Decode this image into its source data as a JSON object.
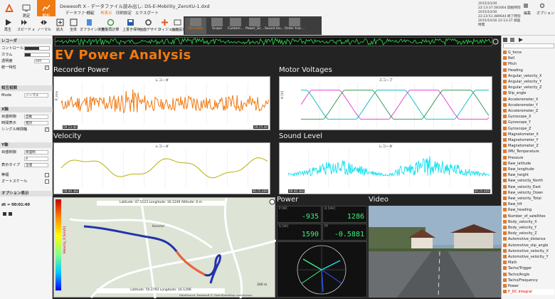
{
  "window": {
    "title": "Dewesoft X - データファイル読み出し: DS-E-Mobility_ZeroXU-1.dxd"
  },
  "main_buttons": [
    {
      "label": "測定"
    },
    {
      "label": "解析"
    }
  ],
  "ribbon_tabs": [
    {
      "label": "データファイル"
    },
    {
      "label": "設定"
    },
    {
      "label": "再表示"
    },
    {
      "label": "印刷設定"
    },
    {
      "label": "エクスポート"
    }
  ],
  "toolbar": [
    {
      "label": "再生"
    },
    {
      "label": "スピード x"
    },
    {
      "label": "ノーマル"
    },
    {
      "label": "拡大"
    },
    {
      "label": "全体"
    },
    {
      "label": "オフライン演算"
    },
    {
      "label": "自動再計算"
    },
    {
      "label": "上書き保存"
    },
    {
      "label": "画面デザイン"
    },
    {
      "label": "ウィジェット"
    },
    {
      "label": "画面設定"
    }
  ],
  "visual_tabs": [
    {
      "label": "Recorder"
    },
    {
      "label": "Scope"
    },
    {
      "label": "Custom..."
    },
    {
      "label": "Power_Sc..."
    },
    {
      "label": "Sound lev..."
    },
    {
      "label": "Order trac..."
    }
  ],
  "top_right": {
    "times": [
      "2015/10/30 22:13:37.581664 開始時刻",
      "2015/10/30 22:23:51.489644 終了時刻",
      "2015/10/30 22:13:37 録画時間"
    ],
    "edit": "編集",
    "options": "オプション"
  },
  "left_panel": {
    "recorder_section": "レコーダ",
    "rows": [
      {
        "label": "コントロール",
        "kind": "slider"
      },
      {
        "label": "カラム",
        "kind": "slider"
      },
      {
        "label": "透明度",
        "value": "OFF"
      },
      {
        "label": "統一特性",
        "kind": "check"
      }
    ],
    "timebase_section": "相互相関",
    "mode_label": "Mode",
    "mode_value": "ノーマル",
    "x_section": "X軸",
    "x_rows": [
      {
        "label": "目盛制御",
        "value": "自動"
      },
      {
        "label": "時間表示",
        "value": "相対"
      },
      {
        "label": "シングル時間軸",
        "kind": "check"
      }
    ],
    "y_section": "Y軸",
    "y_rows": [
      {
        "label": "目盛制御",
        "value": "目盛制"
      },
      {
        "label": "",
        "value": "4"
      },
      {
        "label": "表示タイプ",
        "value": "全値"
      },
      {
        "label": "等幅",
        "kind": "check"
      },
      {
        "label": "オートスケール",
        "kind": "check"
      }
    ],
    "options_section": "オプション表示",
    "dt_label": "dt = 00:01:40"
  },
  "main": {
    "heading": "EV Power Analysis",
    "panels": {
      "recorder": {
        "title": "Recorder Power",
        "inner_title": "レコーダ",
        "y_label": "P_rms",
        "start": "09:23:40",
        "end": "09:25:40"
      },
      "motor": {
        "title": "Motor Voltages",
        "inner_title": "スコープ",
        "y_label": "U [V]"
      },
      "velocity": {
        "title": "Velocity",
        "inner_title": "レコーダ",
        "start": "09:40:382",
        "end": "09:25:409"
      },
      "sound": {
        "title": "Sound Level",
        "inner_title": "レコーダ",
        "start": "09:40:382",
        "end": "09:25:409"
      },
      "map": {
        "top_info": "Latitude: 47.5123  Longitude: 16.1249  Altitude: 0 m",
        "bottom_info": "Latitude: 50.2793  Longitude: 16.1296",
        "scale": "300 m",
        "place": "Kamitzl",
        "legend_label": "Velocity_X [km/h]",
        "attribution": "DataSource: Dewesoft  © OpenStreetMap contributors"
      },
      "power": {
        "title": "Power",
        "values": [
          {
            "label": "P [W]",
            "value": "-935"
          },
          {
            "label": "Q [VAr]",
            "value": "1286"
          },
          {
            "label": "S [VA]",
            "value": "1590"
          },
          {
            "label": "PF",
            "value": "-0.5881"
          }
        ]
      },
      "video": {
        "title": "Video"
      }
    }
  },
  "channels": [
    "G_force",
    "Roll",
    "Pitch",
    "Heading",
    "Angular_velocity_X",
    "Angular_velocity_Y",
    "Angular_velocity_Z",
    "Slip_angle",
    "Accelerometer_X",
    "Accelerometer_Y",
    "Accelerometer_Z",
    "Gyroscope_X",
    "Gyroscope_Y",
    "Gyroscope_Z",
    "Magnetometer_X",
    "Magnetometer_Y",
    "Magnetometer_Z",
    "IMU_Temperature",
    "Pressure",
    "Raw_latitude",
    "Raw_longitude",
    "Raw_height",
    "Raw_velocity_North",
    "Raw_velocity_East",
    "Raw_velocity_Down",
    "Raw_velocity_Total",
    "Raw_tilt",
    "Raw_heading",
    "Number_of_satellites",
    "Body_velocity_X",
    "Body_velocity_Y",
    "Body_velocity_Z",
    "Automotive_distance",
    "Automotive_slip_angle",
    "Automotive_velocity_X",
    "Automotive_velocity_Y",
    "Math",
    "Tacho/Trigger",
    "Tacho/Angle",
    "Tacho/Frequency",
    "Power",
    "P_DC Integral"
  ],
  "colors": {
    "accent": "#f07a12",
    "green": "#3cf07a",
    "cyan": "#18e0f0"
  }
}
